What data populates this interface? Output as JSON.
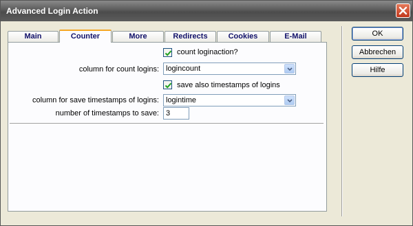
{
  "window": {
    "title": "Advanced Login Action"
  },
  "tabs": [
    {
      "label": "Main",
      "active": false
    },
    {
      "label": "Counter",
      "active": true
    },
    {
      "label": "More",
      "active": false
    },
    {
      "label": "Redirects",
      "active": false
    },
    {
      "label": "Cookies",
      "active": false
    },
    {
      "label": "E-Mail",
      "active": false
    }
  ],
  "counter": {
    "count_checkbox": {
      "label": "count loginaction?",
      "checked": true
    },
    "count_column": {
      "label": "column for count logins:",
      "value": "logincount"
    },
    "timestamps_checkbox": {
      "label": "save also timestamps of logins",
      "checked": true
    },
    "timestamps_column": {
      "label": "column for save timestamps of logins:",
      "value": "logintime"
    },
    "timestamps_number": {
      "label": "number of timestamps to save:",
      "value": "3"
    }
  },
  "buttons": {
    "ok": "OK",
    "cancel": "Abbrechen",
    "help": "Hilfe"
  },
  "colors": {
    "title_bar": "#5a5a5a",
    "active_tab_accent": "#f5a623",
    "tab_text": "#11116a",
    "check": "#21a121",
    "close": "#c2371c"
  }
}
